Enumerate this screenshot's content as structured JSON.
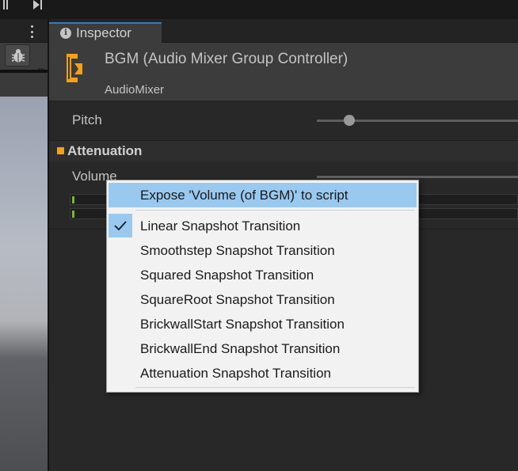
{
  "inspector": {
    "tab_label": "Inspector",
    "title": "BGM (Audio Mixer Group Controller)",
    "subtitle": "AudioMixer",
    "pitch_label": "Pitch",
    "section_label": "Attenuation",
    "volume_label": "Volume"
  },
  "context_menu": {
    "items": [
      "Expose 'Volume (of BGM)' to script",
      "Linear Snapshot Transition",
      "Smoothstep Snapshot Transition",
      "Squared Snapshot Transition",
      "SquareRoot Snapshot Transition",
      "BrickwallStart Snapshot Transition",
      "BrickwallEnd Snapshot Transition",
      "Attenuation Snapshot Transition"
    ],
    "highlighted_index": 0,
    "checked_index": 1
  },
  "icons": [
    "pause-icon",
    "step-icon",
    "kebab-menu-icon",
    "bug-icon",
    "info-icon",
    "audio-mixer-group-icon",
    "checkmark-icon"
  ],
  "colors": {
    "accent_orange": "#f7a10f",
    "menu_highlight": "#99c9ef",
    "tab_accent": "#3a79bb",
    "meter_green": "#7bb33c"
  }
}
